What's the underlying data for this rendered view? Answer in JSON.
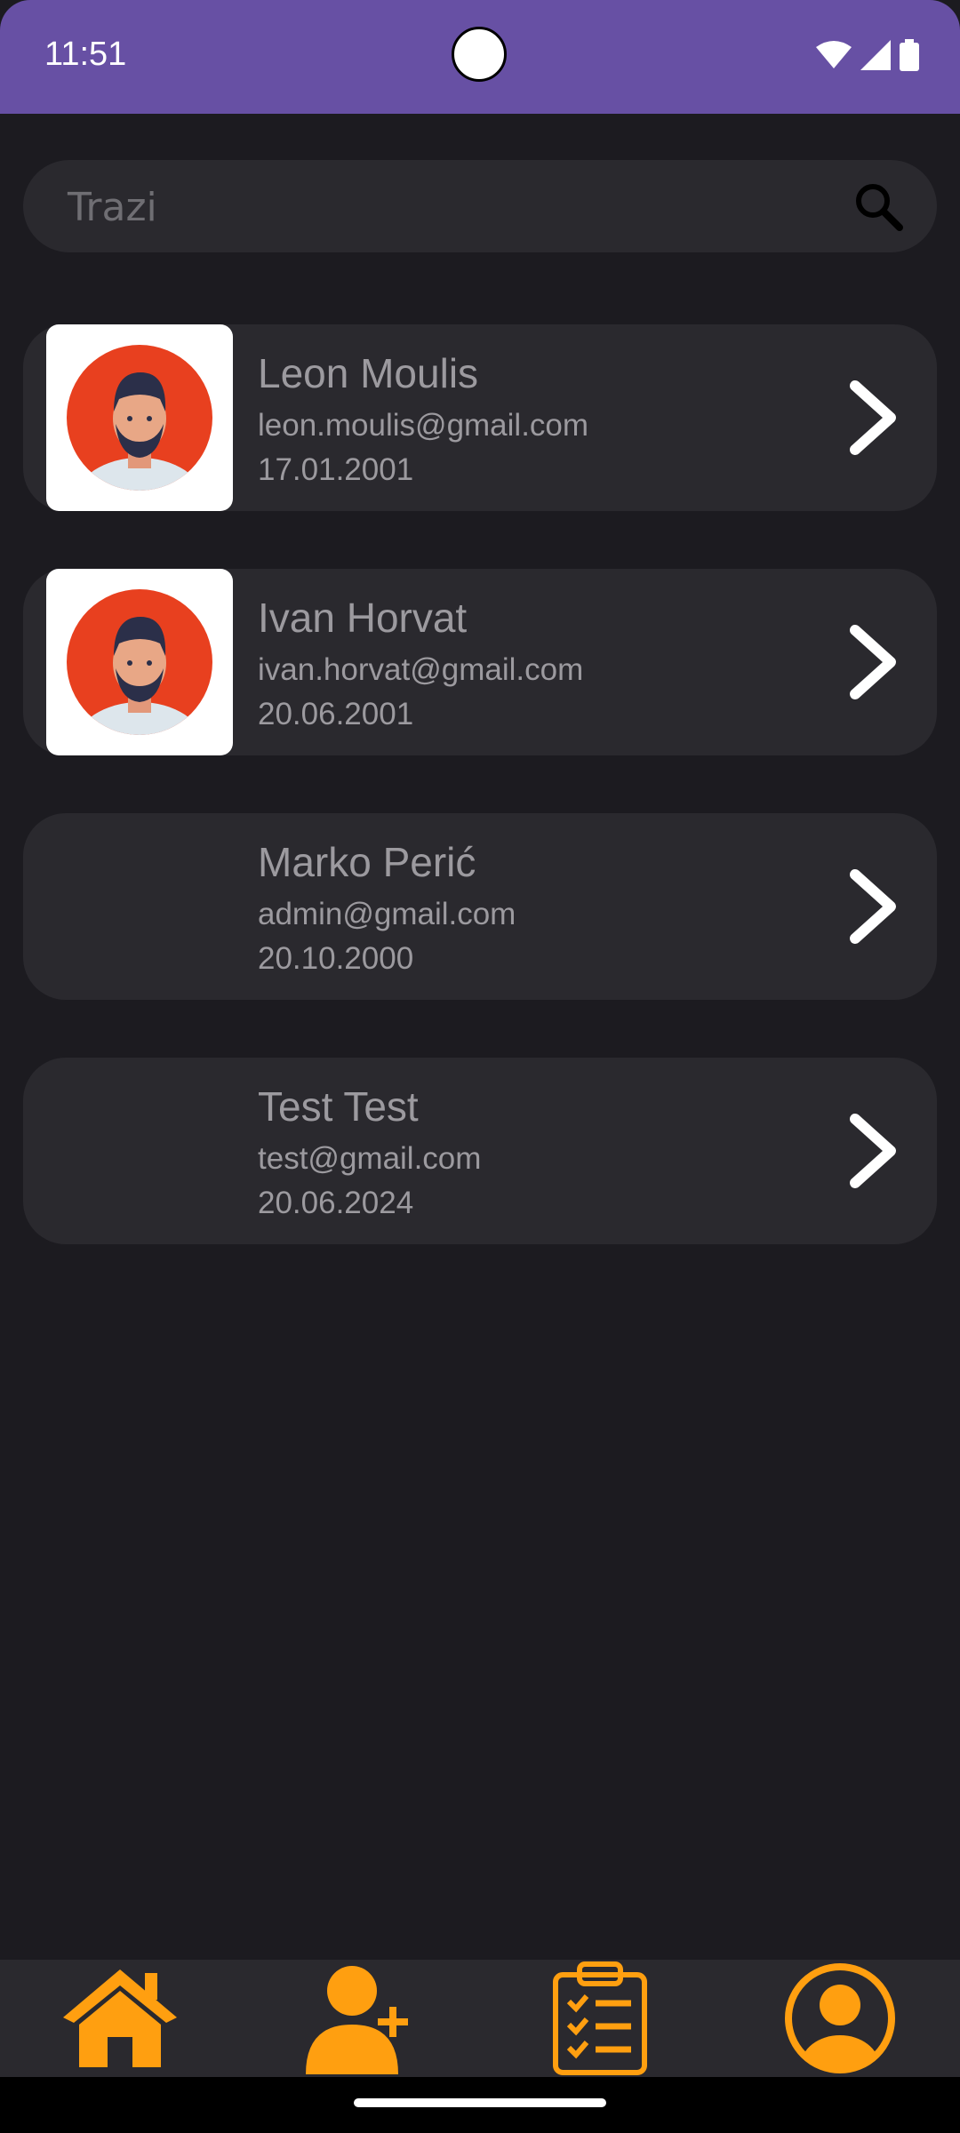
{
  "status_bar": {
    "time": "11:51",
    "icons": [
      "wifi-icon",
      "signal-icon",
      "battery-icon"
    ]
  },
  "search": {
    "placeholder": "Trazi",
    "icon": "search-icon"
  },
  "users": [
    {
      "name": "Leon Moulis",
      "email": "leon.moulis@gmail.com",
      "date": "17.01.2001",
      "has_avatar": true
    },
    {
      "name": "Ivan Horvat",
      "email": "ivan.horvat@gmail.com",
      "date": "20.06.2001",
      "has_avatar": true
    },
    {
      "name": "Marko Perić",
      "email": "admin@gmail.com",
      "date": "20.10.2000",
      "has_avatar": false
    },
    {
      "name": "Test Test",
      "email": "test@gmail.com",
      "date": "20.06.2024",
      "has_avatar": false
    }
  ],
  "bottom_nav": {
    "items": [
      "home-icon",
      "add-user-icon",
      "clipboard-checklist-icon",
      "profile-icon"
    ]
  },
  "colors": {
    "status_bar": "#6750a4",
    "background": "#1c1b20",
    "card": "#2a292e",
    "accent": "#ff9f10",
    "text": "#9c9a9f"
  }
}
